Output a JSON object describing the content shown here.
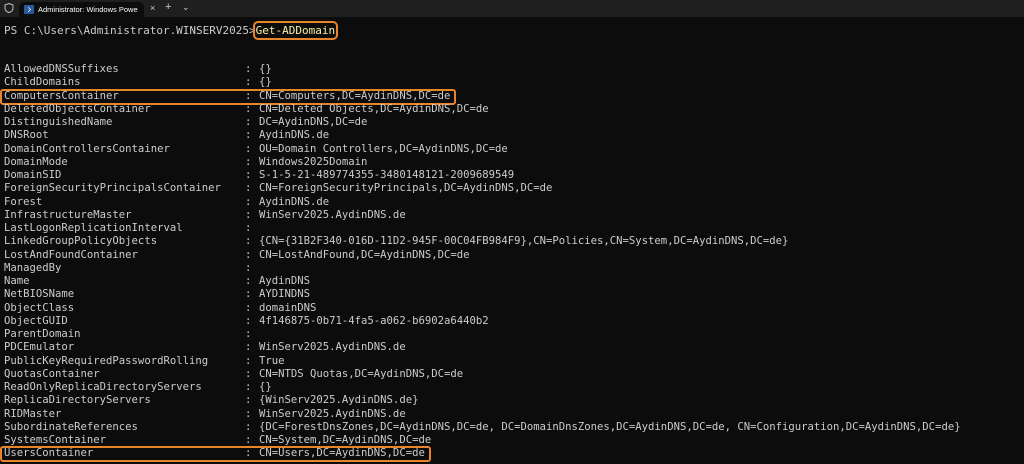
{
  "window": {
    "tab_title": "Administrator: Windows Powe",
    "close_glyph": "×",
    "add_glyph": "+",
    "dropdown_glyph": "⌄"
  },
  "console": {
    "prompt": "PS C:\\Users\\Administrator.WINSERV2025>",
    "command": "Get-ADDomain",
    "separator": ":",
    "properties": [
      {
        "name": "AllowedDNSSuffixes",
        "value": "{}"
      },
      {
        "name": "ChildDomains",
        "value": "{}"
      },
      {
        "name": "ComputersContainer",
        "value": "CN=Computers,DC=AydinDNS,DC=de",
        "highlight": true
      },
      {
        "name": "DeletedObjectsContainer",
        "value": "CN=Deleted Objects,DC=AydinDNS,DC=de"
      },
      {
        "name": "DistinguishedName",
        "value": "DC=AydinDNS,DC=de"
      },
      {
        "name": "DNSRoot",
        "value": "AydinDNS.de"
      },
      {
        "name": "DomainControllersContainer",
        "value": "OU=Domain Controllers,DC=AydinDNS,DC=de"
      },
      {
        "name": "DomainMode",
        "value": "Windows2025Domain"
      },
      {
        "name": "DomainSID",
        "value": "S-1-5-21-489774355-3480148121-2009689549"
      },
      {
        "name": "ForeignSecurityPrincipalsContainer",
        "value": "CN=ForeignSecurityPrincipals,DC=AydinDNS,DC=de"
      },
      {
        "name": "Forest",
        "value": "AydinDNS.de"
      },
      {
        "name": "InfrastructureMaster",
        "value": "WinServ2025.AydinDNS.de"
      },
      {
        "name": "LastLogonReplicationInterval",
        "value": ""
      },
      {
        "name": "LinkedGroupPolicyObjects",
        "value": "{CN={31B2F340-016D-11D2-945F-00C04FB984F9},CN=Policies,CN=System,DC=AydinDNS,DC=de}"
      },
      {
        "name": "LostAndFoundContainer",
        "value": "CN=LostAndFound,DC=AydinDNS,DC=de"
      },
      {
        "name": "ManagedBy",
        "value": ""
      },
      {
        "name": "Name",
        "value": "AydinDNS"
      },
      {
        "name": "NetBIOSName",
        "value": "AYDINDNS"
      },
      {
        "name": "ObjectClass",
        "value": "domainDNS"
      },
      {
        "name": "ObjectGUID",
        "value": "4f146875-0b71-4fa5-a062-b6902a6440b2"
      },
      {
        "name": "ParentDomain",
        "value": ""
      },
      {
        "name": "PDCEmulator",
        "value": "WinServ2025.AydinDNS.de"
      },
      {
        "name": "PublicKeyRequiredPasswordRolling",
        "value": "True"
      },
      {
        "name": "QuotasContainer",
        "value": "CN=NTDS Quotas,DC=AydinDNS,DC=de"
      },
      {
        "name": "ReadOnlyReplicaDirectoryServers",
        "value": "{}"
      },
      {
        "name": "ReplicaDirectoryServers",
        "value": "{WinServ2025.AydinDNS.de}"
      },
      {
        "name": "RIDMaster",
        "value": "WinServ2025.AydinDNS.de"
      },
      {
        "name": "SubordinateReferences",
        "value": "{DC=ForestDnsZones,DC=AydinDNS,DC=de, DC=DomainDnsZones,DC=AydinDNS,DC=de, CN=Configuration,DC=AydinDNS,DC=de}"
      },
      {
        "name": "SystemsContainer",
        "value": "CN=System,DC=AydinDNS,DC=de"
      },
      {
        "name": "UsersContainer",
        "value": "CN=Users,DC=AydinDNS,DC=de",
        "highlight": true
      }
    ]
  },
  "colors": {
    "background": "#0c0c0c",
    "text": "#cccccc",
    "command": "#f9f1a5",
    "highlight_box": "#e8842a",
    "titlebar": "#1f1f1f"
  }
}
